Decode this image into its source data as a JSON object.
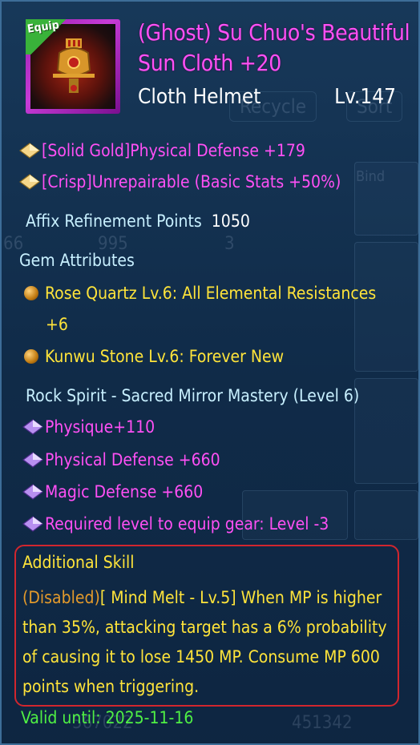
{
  "item": {
    "equip_tag": "Equip",
    "title": "(Ghost) Su Chuo's Beautiful Sun Cloth +20",
    "type": "Cloth Helmet",
    "level": "Lv.147",
    "icon": "helmet-icon"
  },
  "base_stats": [
    {
      "text": "[Solid Gold]Physical Defense +179",
      "icon": "gold-diamond-icon"
    },
    {
      "text": "[Crisp]Unrepairable (Basic Stats +50%)",
      "icon": "gold-diamond-icon"
    }
  ],
  "affix": {
    "label": "Affix Refinement Points",
    "value": "1050"
  },
  "gems": {
    "header": "Gem Attributes",
    "items": [
      {
        "line1": "Rose Quartz Lv.6: All Elemental Resistances",
        "line2": "+6",
        "icon": "gem-orb-icon"
      },
      {
        "line1": "Kunwu Stone Lv.6: Forever New",
        "icon": "gem-orb-icon"
      }
    ]
  },
  "spirit": {
    "header": "Rock Spirit - Sacred Mirror Mastery (Level 6)",
    "items": [
      {
        "text": "Physique+110",
        "icon": "purple-diamond-icon"
      },
      {
        "text": "Physical Defense +660",
        "icon": "purple-diamond-icon"
      },
      {
        "text": "Magic Defense +660",
        "icon": "purple-diamond-icon"
      },
      {
        "text": "Required level to equip gear: Level -3",
        "icon": "purple-diamond-icon"
      }
    ]
  },
  "skill": {
    "header": "Additional Skill",
    "status": "(Disabled)",
    "description": "[ Mind Melt - Lv.5] When MP is higher than 35%, attacking target has a 6% probability of causing it to lose 1450 MP. Consume MP 600 points when triggering."
  },
  "validity": "Valid until: 2025-11-16",
  "background": {
    "buttons": [
      "Recycle",
      "Sort"
    ],
    "numbers": [
      "995",
      "3",
      "66",
      "451342",
      "567022"
    ],
    "bind_label": "Bind"
  },
  "colors": {
    "title": "#ff50f5",
    "stat_yellow": "#ffe43a",
    "disabled": "#e39a2b",
    "valid": "#4ff044",
    "skill_border": "#d1262e"
  }
}
